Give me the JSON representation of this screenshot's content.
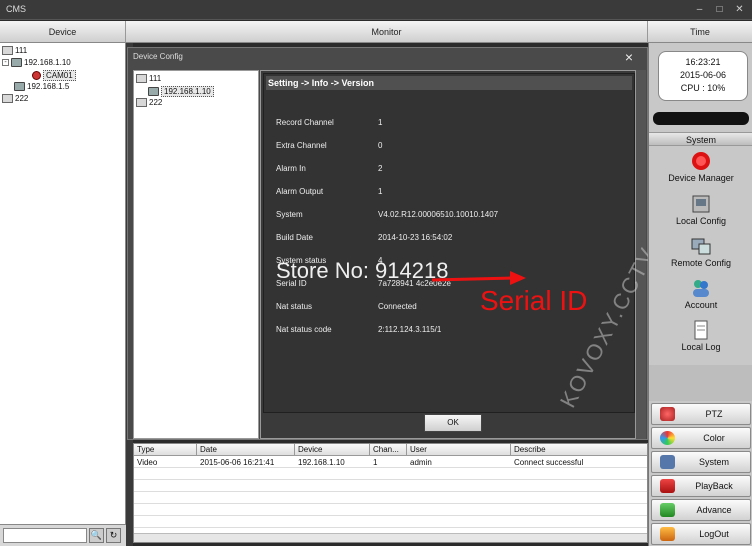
{
  "window": {
    "title": "CMS"
  },
  "columns": {
    "device": "Device",
    "monitor": "Monitor",
    "time": "Time"
  },
  "device_tree": [
    {
      "label": "111",
      "icon": "folder-icon",
      "indent": 0
    },
    {
      "label": "192.168.1.10",
      "icon": "device-icon",
      "indent": 1,
      "expanded": true
    },
    {
      "label": "CAM01",
      "icon": "camera-icon",
      "indent": 2,
      "selected": true
    },
    {
      "label": "192.168.1.5",
      "icon": "device-icon",
      "indent": 1
    },
    {
      "label": "222",
      "icon": "folder-icon",
      "indent": 0
    }
  ],
  "dialog": {
    "title": "Device Config",
    "close_label": "×",
    "tree": [
      {
        "label": "111",
        "icon": "folder-icon"
      },
      {
        "label": "192.168.1.10",
        "icon": "device-icon",
        "selected": true
      },
      {
        "label": "222",
        "icon": "folder-icon"
      }
    ],
    "breadcrumb": "Setting -> Info -> Version",
    "info": [
      {
        "label": "Record Channel",
        "value": "1"
      },
      {
        "label": "Extra Channel",
        "value": "0"
      },
      {
        "label": "Alarm In",
        "value": "2"
      },
      {
        "label": "Alarm Output",
        "value": "1"
      },
      {
        "label": "System",
        "value": "V4.02.R12.00006510.10010.1407"
      },
      {
        "label": "Build Date",
        "value": "2014-10-23 16:54:02"
      },
      {
        "label": "System status",
        "value": "4"
      },
      {
        "label": "Serial ID",
        "value": "7a728941 4c2e0e2e"
      },
      {
        "label": "Nat status",
        "value": "Connected"
      },
      {
        "label": "Nat status code",
        "value": "2:112.124.3.115/1"
      }
    ],
    "ok_label": "OK"
  },
  "overlays": {
    "store_watermark": "Store No: 914218",
    "serial_callout": "Serial ID",
    "diagonal_watermark": "KOVOXY.CCTV"
  },
  "log": {
    "columns": [
      "Type",
      "Date",
      "Device",
      "Chan...",
      "User",
      "Describe"
    ],
    "rows": [
      [
        "Video",
        "2015-06-06 16:21:41",
        "192.168.1.10",
        "1",
        "admin",
        "Connect successful"
      ]
    ]
  },
  "status": {
    "time": "16:23:21",
    "date": "2015-06-06",
    "cpu": "CPU : 10%"
  },
  "system_section": {
    "title": "System",
    "tools": [
      {
        "label": "Device Manager",
        "icon": "device-manager-icon"
      },
      {
        "label": "Local Config",
        "icon": "local-config-icon"
      },
      {
        "label": "Remote Config",
        "icon": "remote-config-icon"
      },
      {
        "label": "Account",
        "icon": "account-icon"
      },
      {
        "label": "Local Log",
        "icon": "local-log-icon"
      }
    ]
  },
  "nav_buttons": [
    {
      "label": "PTZ",
      "icon": "ptz-icon"
    },
    {
      "label": "Color",
      "icon": "color-icon"
    },
    {
      "label": "System",
      "icon": "system-icon"
    },
    {
      "label": "PlayBack",
      "icon": "playback-icon"
    },
    {
      "label": "Advance",
      "icon": "advance-icon"
    },
    {
      "label": "LogOut",
      "icon": "logout-icon"
    }
  ],
  "colors": {
    "callout": "#ee1111",
    "panel": "#333333",
    "sidebar": "#c8c8c8"
  }
}
